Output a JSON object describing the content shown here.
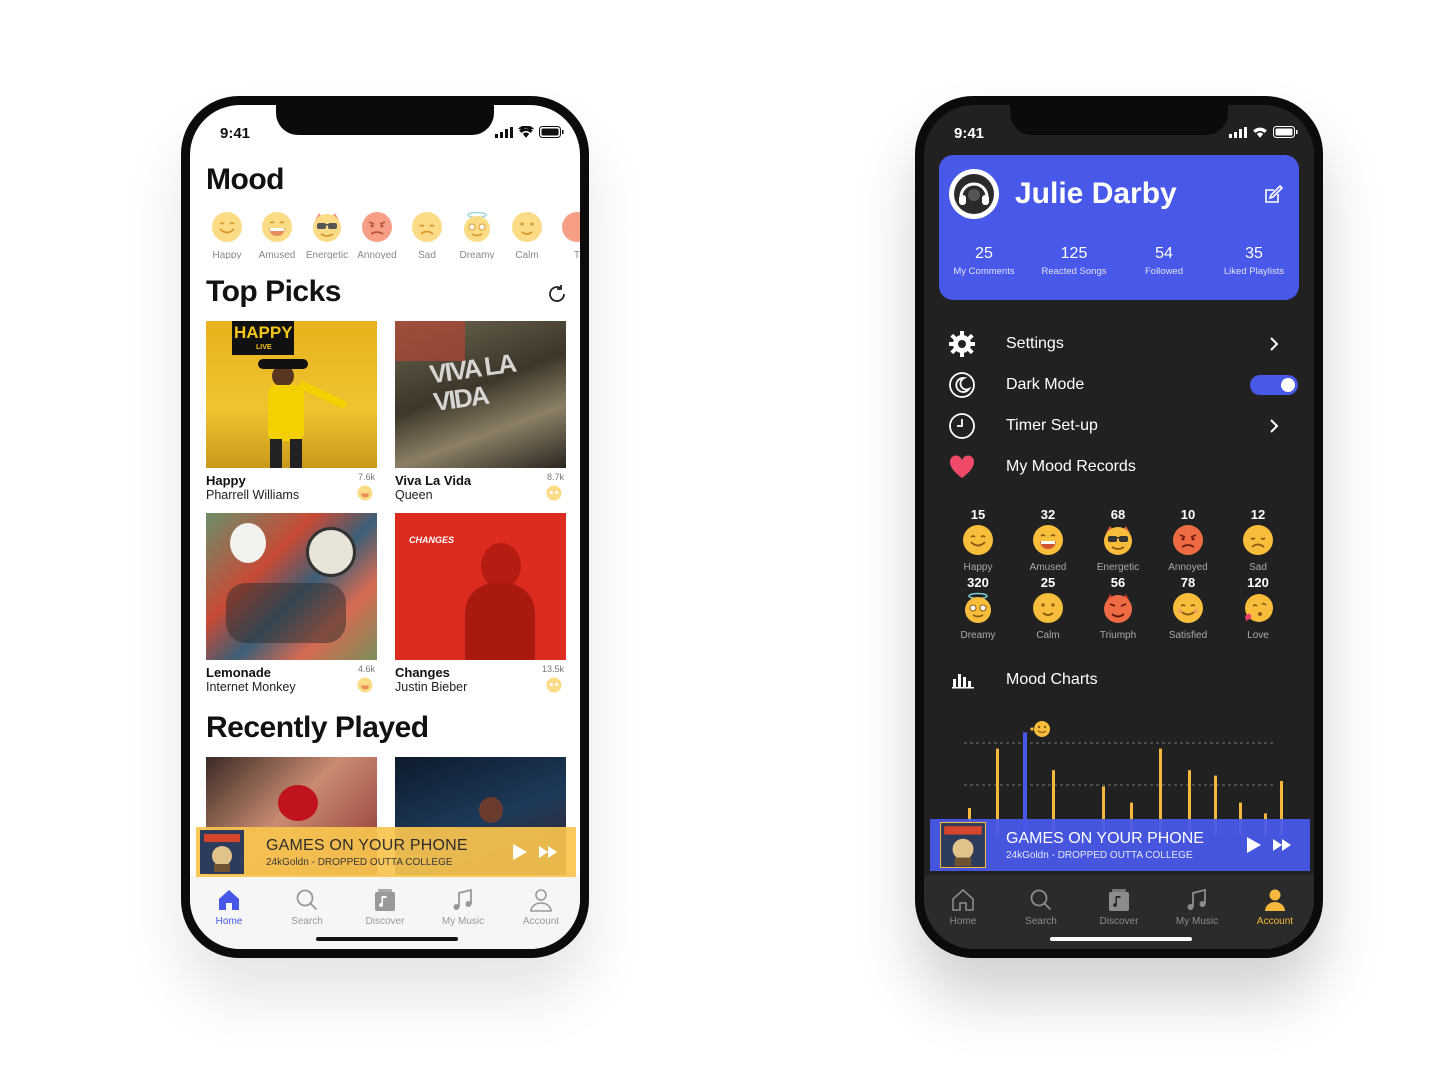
{
  "status": {
    "time": "9:41"
  },
  "home": {
    "mood_title": "Mood",
    "moods": [
      {
        "label": "Happy",
        "icon": "happy-emoji-icon"
      },
      {
        "label": "Amused",
        "icon": "amused-emoji-icon"
      },
      {
        "label": "Energetic",
        "icon": "energetic-emoji-icon"
      },
      {
        "label": "Annoyed",
        "icon": "annoyed-emoji-icon"
      },
      {
        "label": "Sad",
        "icon": "sad-emoji-icon"
      },
      {
        "label": "Dreamy",
        "icon": "dreamy-emoji-icon"
      },
      {
        "label": "Calm",
        "icon": "calm-emoji-icon"
      },
      {
        "label": "T",
        "icon": "triumph-emoji-icon"
      }
    ],
    "top_picks_title": "Top Picks",
    "picks": [
      {
        "title": "Happy",
        "artist": "Pharrell Williams",
        "count": "7.6k",
        "art_text": "HAPPY",
        "art_sub": "LIVE"
      },
      {
        "title": "Viva La Vida",
        "artist": "Queen",
        "count": "8.7k",
        "art_text": "VIVA LA VIDA"
      },
      {
        "title": "Lemonade",
        "artist": "Internet Monkey",
        "count": "4.6k"
      },
      {
        "title": "Changes",
        "artist": "Justin Bieber",
        "count": "13.5k",
        "art_text": "CHANGES"
      }
    ],
    "recently_played_title": "Recently Played",
    "player": {
      "title": "GAMES ON YOUR PHONE",
      "subtitle": "24kGoldn - DROPPED OUTTA COLLEGE"
    },
    "tabs": [
      {
        "label": "Home",
        "icon": "home-icon",
        "active": true
      },
      {
        "label": "Search",
        "icon": "search-icon"
      },
      {
        "label": "Discover",
        "icon": "discover-icon"
      },
      {
        "label": "My Music",
        "icon": "music-note-icon"
      },
      {
        "label": "Account",
        "icon": "account-icon"
      }
    ]
  },
  "account": {
    "name": "Julie Darby",
    "stats": [
      {
        "value": "25",
        "label": "My Comments"
      },
      {
        "value": "125",
        "label": "Reacted Songs"
      },
      {
        "value": "54",
        "label": "Followed"
      },
      {
        "value": "35",
        "label": "Liked Playlists"
      }
    ],
    "menu": [
      {
        "label": "Settings",
        "icon": "gear-icon"
      },
      {
        "label": "Dark Mode",
        "icon": "moon-icon",
        "toggle_on": true
      },
      {
        "label": "Timer Set-up",
        "icon": "clock-icon"
      },
      {
        "label": "My Mood Records",
        "icon": "heart-icon"
      }
    ],
    "mood_records": [
      {
        "value": "15",
        "label": "Happy"
      },
      {
        "value": "32",
        "label": "Amused"
      },
      {
        "value": "68",
        "label": "Energetic"
      },
      {
        "value": "10",
        "label": "Annoyed"
      },
      {
        "value": "12",
        "label": "Sad"
      },
      {
        "value": "320",
        "label": "Dreamy"
      },
      {
        "value": "25",
        "label": "Calm"
      },
      {
        "value": "56",
        "label": "Triumph"
      },
      {
        "value": "78",
        "label": "Satisfied"
      },
      {
        "value": "120",
        "label": "Love"
      }
    ],
    "mood_charts_title": "Mood Charts",
    "player": {
      "title": "GAMES ON YOUR PHONE",
      "subtitle": "24kGoldn - DROPPED OUTTA COLLEGE"
    },
    "tabs": [
      {
        "label": "Home",
        "icon": "home-icon"
      },
      {
        "label": "Search",
        "icon": "search-icon"
      },
      {
        "label": "Discover",
        "icon": "discover-icon"
      },
      {
        "label": "My Music",
        "icon": "music-note-icon"
      },
      {
        "label": "Account",
        "icon": "account-icon",
        "active": true
      }
    ]
  },
  "colors": {
    "accent_blue": "#4858e8",
    "accent_yellow": "#f5b83c",
    "player_yellow": "#f8c44e",
    "dark_bg": "#212121"
  },
  "chart_data": {
    "type": "bar",
    "title": "",
    "series": [
      {
        "values": [
          0.25,
          0.8,
          0.6,
          0.45,
          0.3,
          0.8,
          0.6,
          0.55,
          0.3,
          0.2,
          0.5
        ]
      },
      {
        "values": [
          0.95
        ]
      }
    ],
    "grid": true
  }
}
